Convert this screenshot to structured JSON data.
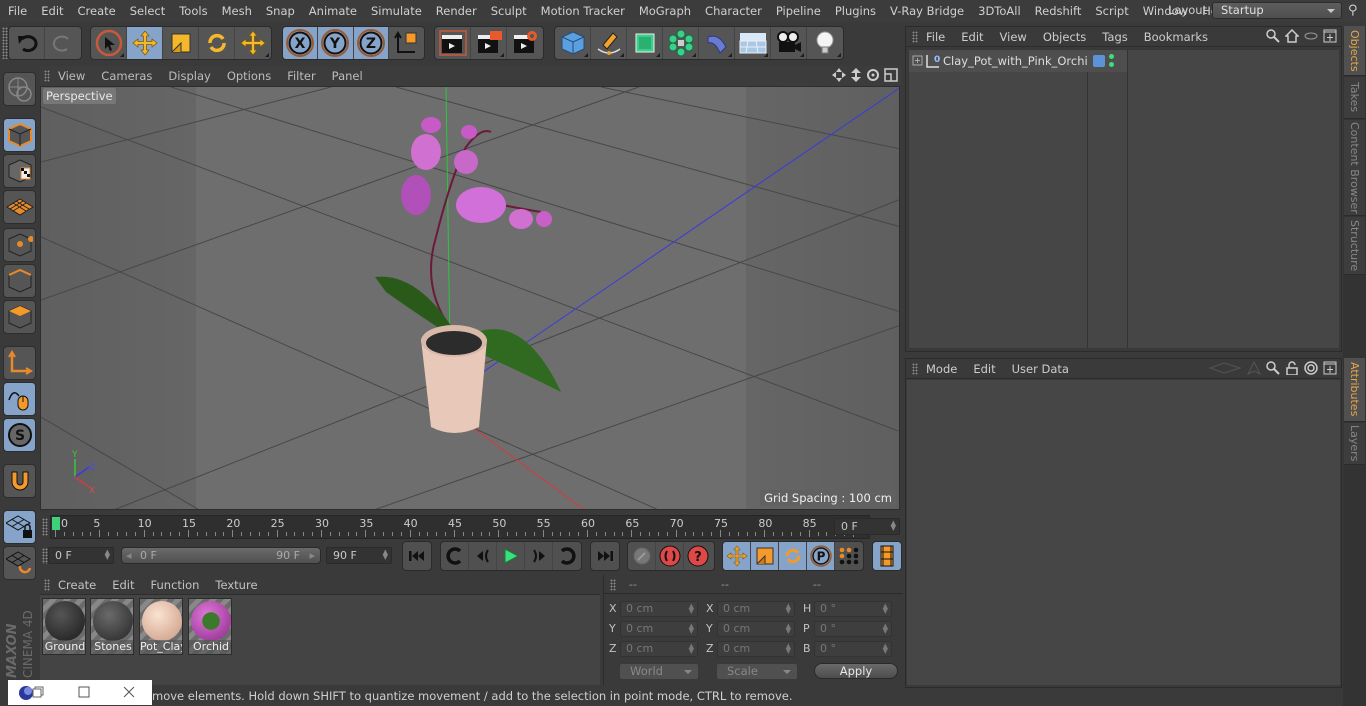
{
  "app": {
    "name": "Cinema 4D"
  },
  "menubar": {
    "items": [
      "File",
      "Edit",
      "Create",
      "Select",
      "Tools",
      "Mesh",
      "Snap",
      "Animate",
      "Simulate",
      "Render",
      "Sculpt",
      "Motion Tracker",
      "MoGraph",
      "Character",
      "Pipeline",
      "Plugins",
      "V-Ray Bridge",
      "3DToAll",
      "Redshift",
      "Script",
      "Window",
      "Help"
    ],
    "layout_label": "Layout:",
    "layout_value": "Startup"
  },
  "toolbar": {
    "icons": [
      "undo-icon",
      "redo-icon",
      "live-selection-icon",
      "move-icon",
      "scale-icon",
      "rotate-icon",
      "recent-tools-icon",
      "x-axis-lock-icon",
      "y-axis-lock-icon",
      "z-axis-lock-icon",
      "coordinate-system-icon",
      "render-view-icon",
      "render-picture-viewer-icon",
      "render-settings-icon",
      "cube-icon",
      "pen-spline-icon",
      "subdivision-icon",
      "cloner-icon",
      "deformer-icon",
      "floor-icon",
      "camera-icon",
      "light-icon"
    ],
    "axis_labels": [
      "X",
      "Y",
      "Z"
    ]
  },
  "left_toolbar": {
    "icons": [
      "make-editable-icon",
      "model-mode-icon",
      "texture-mode-icon",
      "workplane-mode-icon",
      "points-mode-icon",
      "edges-mode-icon",
      "polygons-mode-icon",
      "axis-mode-icon",
      "tweak-mode-icon",
      "solo-icon",
      "snap-magnet-icon",
      "workplane-lock-icon",
      "workplane-align-icon"
    ],
    "solo_label": "S"
  },
  "viewport": {
    "menu": [
      "View",
      "Cameras",
      "Display",
      "Options",
      "Filter",
      "Panel"
    ],
    "camera_label": "Perspective",
    "grid_spacing": "Grid Spacing : 100 cm",
    "axis": {
      "x": "X",
      "y": "Y",
      "z": "Z"
    }
  },
  "timeline": {
    "ticks": [
      "0",
      "5",
      "10",
      "15",
      "20",
      "25",
      "30",
      "35",
      "40",
      "45",
      "50",
      "55",
      "60",
      "65",
      "70",
      "75",
      "80",
      "85",
      "90"
    ],
    "current_frame": "0 F",
    "start_field": "0 F",
    "range_start": "0 F",
    "range_end": "90 F",
    "end_field": "90 F"
  },
  "materials": {
    "menu": [
      "Create",
      "Edit",
      "Function",
      "Texture"
    ],
    "items": [
      {
        "name": "Ground",
        "color": "#3a3a3a"
      },
      {
        "name": "Stones",
        "color": "#4a4a4a"
      },
      {
        "name": "Pot_Clay",
        "color": "#e8c0a8"
      },
      {
        "name": "Orchid",
        "color": "#c04aa8"
      }
    ]
  },
  "coordinates": {
    "headers": [
      "--",
      "--",
      "--"
    ],
    "rows": [
      {
        "l1": "X",
        "v1": "0 cm",
        "l2": "X",
        "v2": "0 cm",
        "l3": "H",
        "v3": "0 °"
      },
      {
        "l1": "Y",
        "v1": "0 cm",
        "l2": "Y",
        "v2": "0 cm",
        "l3": "P",
        "v3": "0 °"
      },
      {
        "l1": "Z",
        "v1": "0 cm",
        "l2": "Z",
        "v2": "0 cm",
        "l3": "B",
        "v3": "0 °"
      }
    ],
    "mode_dropdown": "World",
    "type_dropdown": "Scale",
    "apply_label": "Apply"
  },
  "status": {
    "text": "move elements. Hold down SHIFT to quantize movement / add to the selection in point mode, CTRL to remove."
  },
  "objects_panel": {
    "menu": [
      "File",
      "Edit",
      "View",
      "Objects",
      "Tags",
      "Bookmarks"
    ],
    "objects": [
      {
        "name": "Clay_Pot_with_Pink_Orchid",
        "layer_color": "#5b93d6"
      }
    ]
  },
  "attributes_panel": {
    "menu": [
      "Mode",
      "Edit",
      "User Data"
    ]
  },
  "right_tabs": {
    "top": [
      "Objects",
      "Takes",
      "Content Browser",
      "Structure"
    ],
    "bottom": [
      "Attributes",
      "Layers"
    ],
    "active_color": "#e8a648"
  },
  "branding": {
    "line1": "MAXON",
    "line2": "CINEMA 4D"
  }
}
